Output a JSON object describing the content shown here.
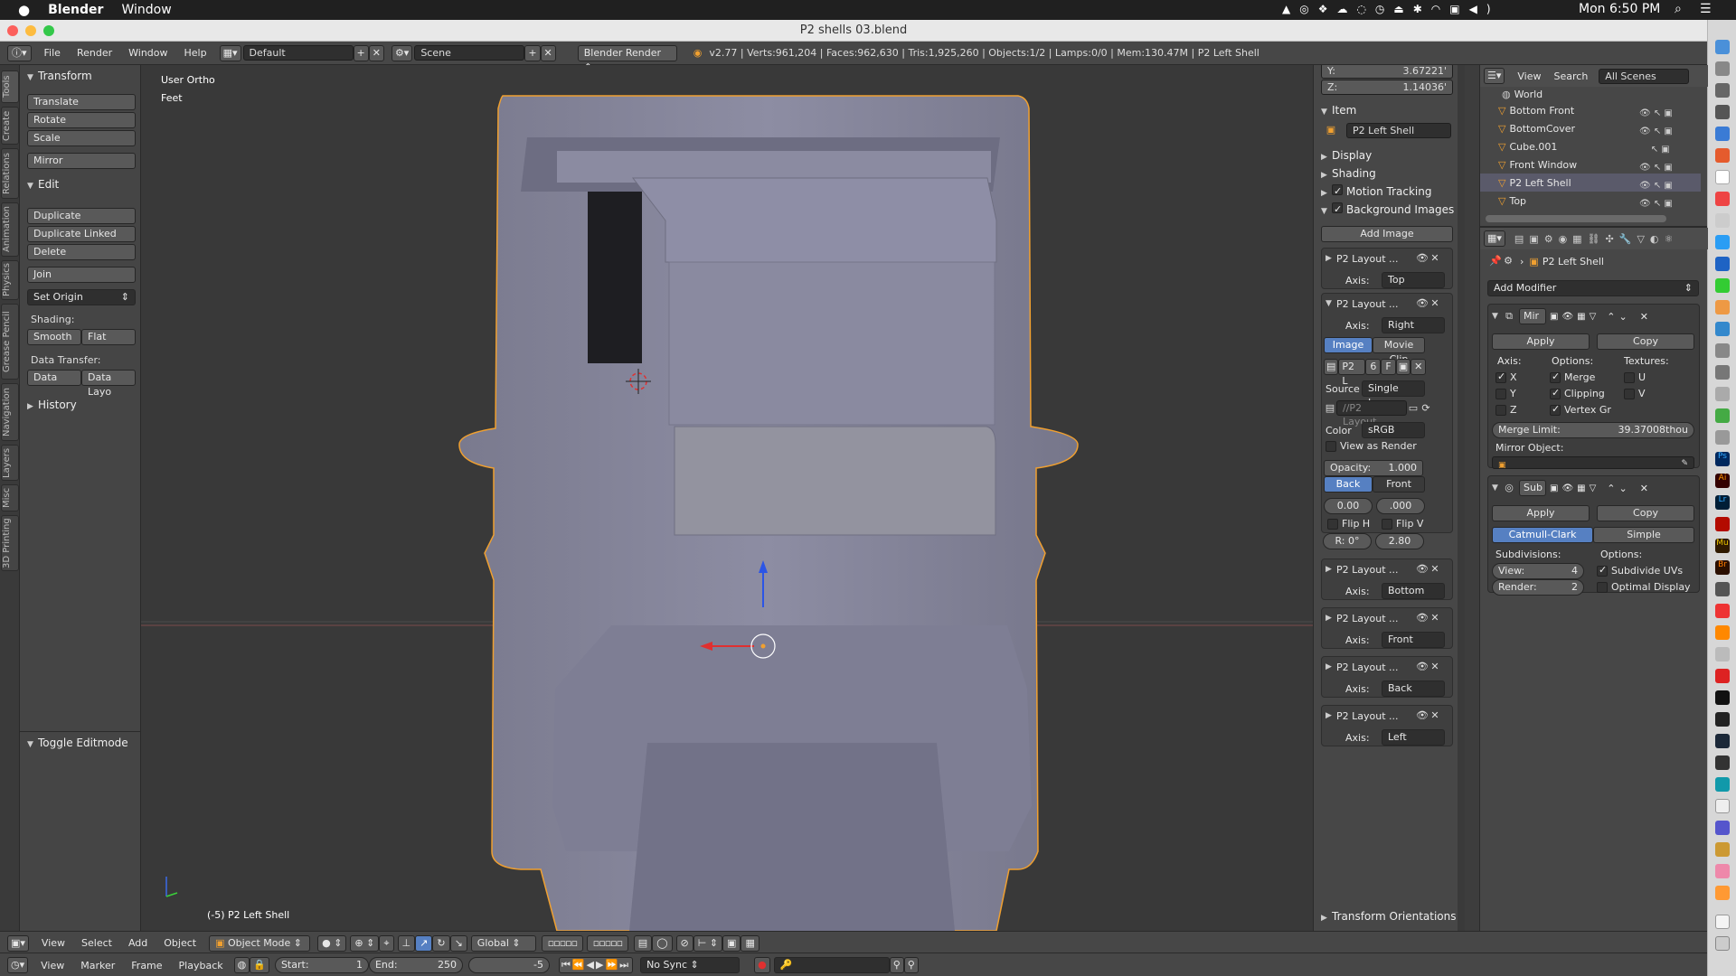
{
  "macbar": {
    "apple": "",
    "app": "Blender",
    "menu": [
      "Window"
    ],
    "clock": "Mon 6:50 PM"
  },
  "titlebar": {
    "title": "P2 shells 03.blend"
  },
  "header": {
    "menus": [
      "File",
      "Render",
      "Window",
      "Help"
    ],
    "layout": "Default",
    "scene": "Scene",
    "engine": "Blender Render",
    "stats": "v2.77 | Verts:961,204 | Faces:962,630 | Tris:1,925,260 | Objects:1/2 | Lamps:0/0 | Mem:130.47M | P2 Left Shell"
  },
  "vtabs": [
    "Tools",
    "Create",
    "Relations",
    "Animation",
    "Physics",
    "Grease Pencil",
    "Navigation",
    "Layers",
    "Misc",
    "3D Printing"
  ],
  "toolpanel": {
    "transform_title": "Transform",
    "transform_btns": [
      "Translate",
      "Rotate",
      "Scale"
    ],
    "mirror": "Mirror",
    "edit_title": "Edit",
    "edit_btns": [
      "Duplicate",
      "Duplicate Linked",
      "Delete"
    ],
    "join": "Join",
    "set_origin": "Set Origin",
    "shading_label": "Shading:",
    "smooth": "Smooth",
    "flat": "Flat",
    "data_transfer_label": "Data Transfer:",
    "data": "Data",
    "data_layo": "Data Layo",
    "history": "History",
    "toggle_editmode": "Toggle Editmode"
  },
  "viewport": {
    "view_name": "User Ortho",
    "units": "Feet",
    "object_label": "(-5) P2 Left Shell"
  },
  "npanel": {
    "y_label": "Y:",
    "y_val": "3.67221'",
    "z_label": "Z:",
    "z_val": "1.14036'",
    "item_title": "Item",
    "item_name": "P2 Left Shell",
    "display": "Display",
    "shading": "Shading",
    "motion_tracking": "Motion Tracking",
    "background_images": "Background Images",
    "add_image": "Add Image",
    "axis_label": "Axis:",
    "bg": [
      {
        "name": "P2 Layout ...",
        "axis": "Top",
        "expanded": false
      },
      {
        "name": "P2 Layout ...",
        "axis": "Right",
        "expanded": true
      },
      {
        "name": "P2 Layout ...",
        "axis": "Bottom",
        "expanded": false
      },
      {
        "name": "P2 Layout ...",
        "axis": "Front",
        "expanded": false
      },
      {
        "name": "P2 Layout ...",
        "axis": "Back",
        "expanded": false
      },
      {
        "name": "P2 Layout ...",
        "axis": "Left",
        "expanded": false
      }
    ],
    "image_tab": "Image",
    "movieclip_tab": "Movie Clip",
    "img_name": "P2 L",
    "img_users": "6",
    "img_fake": "F",
    "source_label": "Source",
    "source_val": "Single Image",
    "filepath": "//P2 Layout...",
    "color_label": "Color",
    "color_val": "sRGB",
    "view_as_render": "View as Render",
    "opacity": "Opacity:",
    "opacity_val": "1.000",
    "back": "Back",
    "front": "Front",
    "offx": "0.00",
    "offy": ".000",
    "flip_h": "Flip H",
    "flip_v": "Flip V",
    "rot": "R: 0°",
    "size": "2.80",
    "transform_orientations": "Transform Orientations"
  },
  "outliner": {
    "menus": [
      "View",
      "Search"
    ],
    "scenes": "All Scenes",
    "items": [
      "World",
      "Bottom Front",
      "BottomCover",
      "Cube.001",
      "Front Window",
      "P2 Left Shell",
      "Top"
    ],
    "selected": "P2 Left Shell"
  },
  "props": {
    "object_name": "P2 Left Shell",
    "add_modifier": "Add Modifier",
    "mirror": {
      "name": "Mir",
      "apply": "Apply",
      "copy": "Copy",
      "axis": "Axis:",
      "options": "Options:",
      "textures": "Textures:",
      "x": "X",
      "y": "Y",
      "z": "Z",
      "merge": "Merge",
      "clipping": "Clipping",
      "vertex_gr": "Vertex Gr",
      "u": "U",
      "v": "V",
      "merge_limit": "Merge Limit:",
      "merge_limit_val": "39.37008thou",
      "mirror_object": "Mirror Object:"
    },
    "subsurf": {
      "name": "Sub",
      "apply": "Apply",
      "copy": "Copy",
      "catmull": "Catmull-Clark",
      "simple": "Simple",
      "subdivisions": "Subdivisions:",
      "options": "Options:",
      "view": "View:",
      "view_val": "4",
      "render": "Render:",
      "render_val": "2",
      "subdivide_uvs": "Subdivide UVs",
      "optimal_display": "Optimal Display"
    }
  },
  "bottom": {
    "menus1": [
      "View",
      "Select",
      "Add",
      "Object"
    ],
    "mode": "Object Mode",
    "orientation": "Global",
    "menus2": [
      "View",
      "Marker",
      "Frame",
      "Playback"
    ],
    "start": "Start:",
    "start_val": "1",
    "end": "End:",
    "end_val": "250",
    "frame": "-5",
    "sync": "No Sync"
  }
}
